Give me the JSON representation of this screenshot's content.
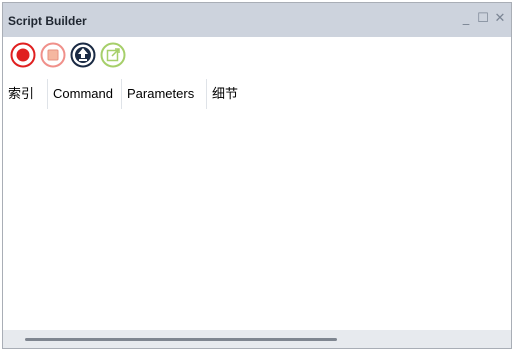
{
  "window": {
    "title": "Script Builder",
    "minimize_glyph": "_",
    "maximize_glyph": "☐",
    "close_glyph": "✕"
  },
  "toolbar": {
    "buttons": [
      {
        "icon": "record-icon",
        "color": "#e02020"
      },
      {
        "icon": "stop-icon",
        "color": "#f0908a"
      },
      {
        "icon": "upload-icon",
        "color": "#1a2a44"
      },
      {
        "icon": "export-icon",
        "color": "#a6cf6a"
      }
    ]
  },
  "table": {
    "columns": [
      "索引",
      "Command",
      "Parameters",
      "细节"
    ],
    "rows": []
  },
  "colors": {
    "titlebar": "#cdd3dd",
    "scrollbar_track": "#e7eaee",
    "scrollbar_thumb": "#7f8690"
  }
}
